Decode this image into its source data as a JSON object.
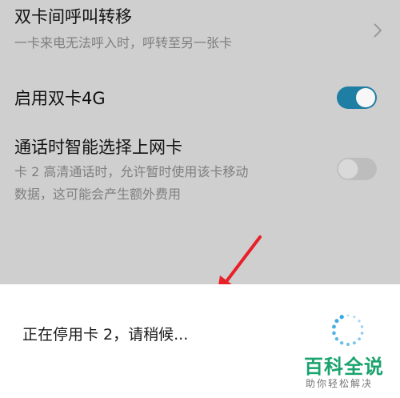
{
  "settings": {
    "call_forward": {
      "title": "双卡间呼叫转移",
      "subtitle": "一卡来电无法呼入时，呼转至另一张卡"
    },
    "dual_4g": {
      "title": "启用双卡4G",
      "enabled": true
    },
    "smart_data": {
      "title": "通话时智能选择上网卡",
      "subtitle_line1": "卡 2 高清通话时，允许暂时使用该卡移动",
      "subtitle_line2": "数据，这可能会产生额外费用",
      "enabled": false
    }
  },
  "dialog": {
    "message": "正在停用卡 2，请稍候..."
  },
  "watermark": {
    "title": "百科全说",
    "subtitle": "助你轻松解决"
  },
  "colors": {
    "accent": "#1e7ea3",
    "annotation_arrow": "#e8202a",
    "watermark": "#1aa36d"
  }
}
